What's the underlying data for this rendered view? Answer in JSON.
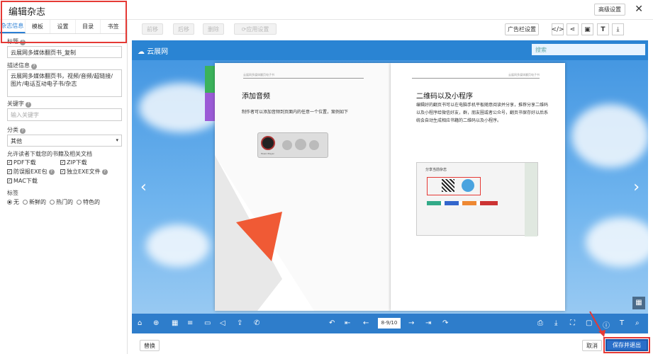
{
  "header": {
    "title": "编辑杂志",
    "advanced_label": "高级设置",
    "close_glyph": "✕"
  },
  "tabs": [
    "杂志信息",
    "模板",
    "设置",
    "目录",
    "书签"
  ],
  "form": {
    "title_label": "标题",
    "title_value": "云展网多媒体翻页书_复制",
    "desc_label": "描述信息",
    "desc_value": "云展网多媒体翻页书，视频/音频/超链接/图片/电话互动电子书/杂志",
    "keyword_label": "关键字",
    "keyword_placeholder": "输入关键字",
    "category_label": "分类",
    "category_value": "其他",
    "allow_label": "允许读者下载您的书籍及相关文档",
    "checks": [
      "PDF下载",
      "ZIP下载",
      "防误报EXE包",
      "独立EXE文件",
      "MAC下载"
    ],
    "tag_label": "标签",
    "tag_options": [
      "无",
      "新鲜的",
      "热门的",
      "特色的"
    ]
  },
  "toolbar": {
    "disabled": [
      "前移",
      "后移",
      "删除",
      "应用设置"
    ],
    "ad_label": "广告栏设置",
    "icons": [
      "</>",
      "share",
      "▣",
      "T",
      "⤓"
    ]
  },
  "viewer": {
    "logo_text": "云展网",
    "search_placeholder": "搜索",
    "left_page_header": "云展网多媒体翻页电子书",
    "left_heading": "添加音频",
    "left_body": "制作者可以添加音频到页面内的任意一个位置，案例如下",
    "player_label": "Music Player",
    "right_page_header": "云展网多媒体翻页电子书",
    "right_heading": "二维码以及小程序",
    "right_body": "编辑好的翻页书可以在电脑手机平板随意阅读并分享，推荐分享二维码以及小程序给微信好友，群，朋友圈或者公众号，翻页书保存好以后系统会自动生成相应书籍的二维码以及小程序。",
    "share_title": "分享当前杂志",
    "page_indicator": "8-9/10"
  },
  "footer": {
    "replace_label": "替换",
    "cancel_label": "取消",
    "save_label": "保存并退出"
  }
}
